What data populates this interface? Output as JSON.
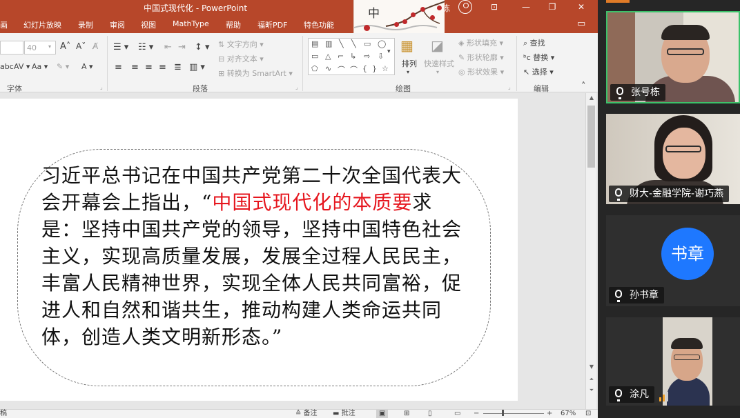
{
  "window": {
    "title": "中国式现代化 - PowerPoint",
    "user_fragment": "栋"
  },
  "tabs": [
    "画",
    "幻灯片放映",
    "录制",
    "审阅",
    "视图",
    "MathType",
    "帮助",
    "福昕PDF",
    "特色功能"
  ],
  "decoration": {
    "text": "中"
  },
  "ribbon": {
    "font_size": "40",
    "font_name": "",
    "groups": {
      "font": "字体",
      "paragraph": "段落",
      "drawing": "绘图",
      "editing": "编辑"
    },
    "paragraph": {
      "text_direction": "文字方向",
      "align_text": "对齐文本",
      "smartart": "转换为 SmartArt"
    },
    "drawing": {
      "arrange": "排列",
      "quick_styles": "快速样式",
      "shape_fill": "形状填充",
      "shape_outline": "形状轮廓",
      "shape_effects": "形状效果"
    },
    "editing": {
      "find": "查找",
      "replace": "替换",
      "select": "选择"
    }
  },
  "slide": {
    "quote_part1": "习近平总书记在中国共产党第二十次全国代表大会开幕会上指出，“",
    "quote_highlight": "中国式现代化的本质要",
    "quote_part2": "求是：坚持中国共产党的领导，坚持中国特色社会主义，实现高质量发展，发展全过程人民民主，丰富人民精神世界，实现全体人民共同富裕，促进人和自然和谐共生，推动构建人类命运共同体，创造人类文明新形态。”"
  },
  "statusbar": {
    "left": "稿",
    "notes": "备注",
    "comments": "批注",
    "zoom": "67%"
  },
  "meeting": {
    "participants": [
      {
        "name": "张号栋"
      },
      {
        "name": "财大-金融学院-谢巧燕"
      },
      {
        "name": "孙书章",
        "avatar_text": "书章",
        "avatar_color": "#1e78ff"
      },
      {
        "name": "涂凡"
      }
    ]
  },
  "colors": {
    "accent": "#b7472a",
    "highlight": "#e6161e",
    "active_speaker": "#3cc26a"
  }
}
